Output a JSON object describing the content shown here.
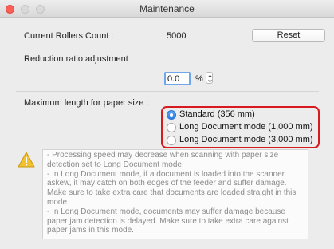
{
  "window": {
    "title": "Maintenance"
  },
  "rollers": {
    "label": "Current Rollers Count :",
    "value": "5000",
    "reset_label": "Reset"
  },
  "reduction": {
    "label": "Reduction ratio adjustment :",
    "value": "0.0",
    "unit": "%"
  },
  "paper": {
    "label": "Maximum length for paper size :",
    "options": [
      {
        "label": "Standard (356 mm)",
        "selected": true
      },
      {
        "label": "Long Document mode (1,000 mm)",
        "selected": false
      },
      {
        "label": "Long Document mode (3,000 mm)",
        "selected": false
      }
    ]
  },
  "notes": [
    "- Processing speed may decrease when scanning with paper size detection set to Long Document mode.",
    "- In Long Document mode, if a document is loaded into the scanner askew, it may catch on both edges of the feeder and suffer damage. Make sure to take extra care that documents are loaded straight in this mode.",
    "- In Long Document mode, documents may suffer damage because paper jam detection is delayed. Make sure to take extra care against paper jams in this mode."
  ],
  "icons": {
    "warning": "warning-triangle-icon",
    "stepper": "up-down-stepper-icon"
  },
  "colors": {
    "highlight": "#d71920",
    "accent": "#2a80e8",
    "warning": "#f2c12e"
  }
}
